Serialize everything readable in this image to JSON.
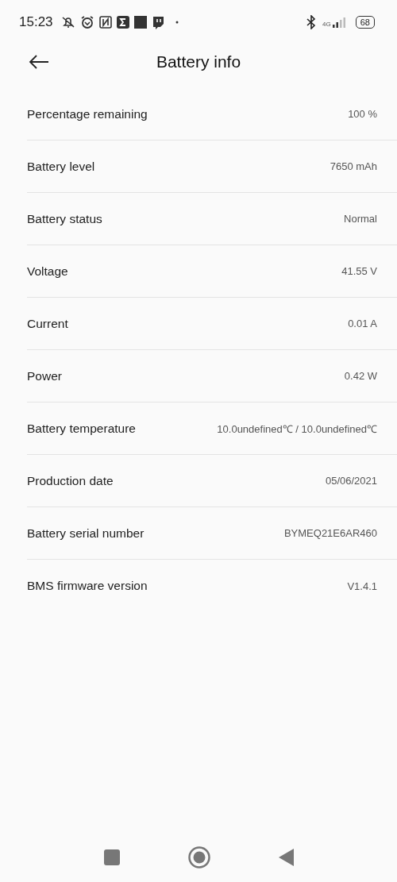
{
  "status_bar": {
    "time": "15:23",
    "network": "4G",
    "battery": "68"
  },
  "header": {
    "title": "Battery info"
  },
  "rows": [
    {
      "label": "Percentage remaining",
      "value": "100 %"
    },
    {
      "label": "Battery level",
      "value": "7650 mAh"
    },
    {
      "label": "Battery status",
      "value": "Normal"
    },
    {
      "label": "Voltage",
      "value": "41.55 V"
    },
    {
      "label": "Current",
      "value": "0.01 A"
    },
    {
      "label": "Power",
      "value": "0.42 W"
    },
    {
      "label": "Battery temperature",
      "value": "10.0undefined℃ / 10.0undefined℃"
    },
    {
      "label": "Production date",
      "value": "05/06/2021"
    },
    {
      "label": "Battery serial number",
      "value": "BYMEQ21E6AR460"
    },
    {
      "label": "BMS firmware version",
      "value": "V1.4.1"
    }
  ]
}
